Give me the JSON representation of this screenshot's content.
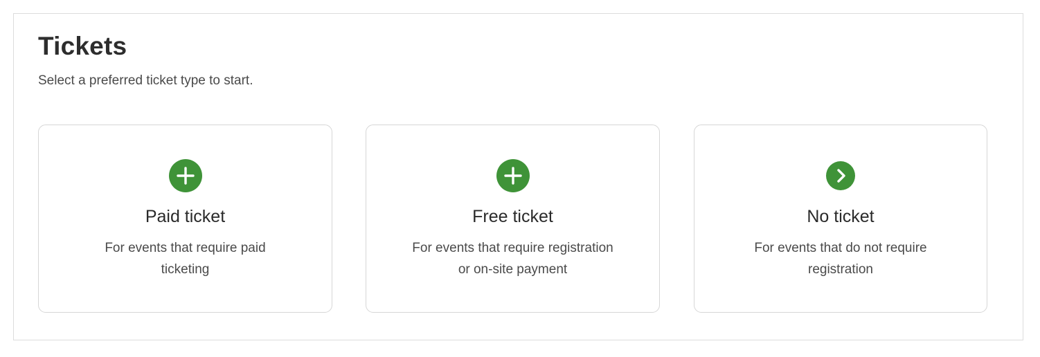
{
  "section": {
    "title": "Tickets",
    "subtitle": "Select a preferred ticket type to start."
  },
  "cards": [
    {
      "icon": "plus-circle-icon",
      "title": "Paid ticket",
      "description": "For events that require paid ticketing"
    },
    {
      "icon": "plus-circle-icon",
      "title": "Free ticket",
      "description": "For events that require registration or on-site payment"
    },
    {
      "icon": "chevron-right-circle-icon",
      "title": "No ticket",
      "description": "For events that do not require registration"
    }
  ],
  "colors": {
    "accent": "#3f9338",
    "border": "#d6d6d6",
    "text": "#2b2b2b",
    "muted_text": "#4a4a4a"
  }
}
